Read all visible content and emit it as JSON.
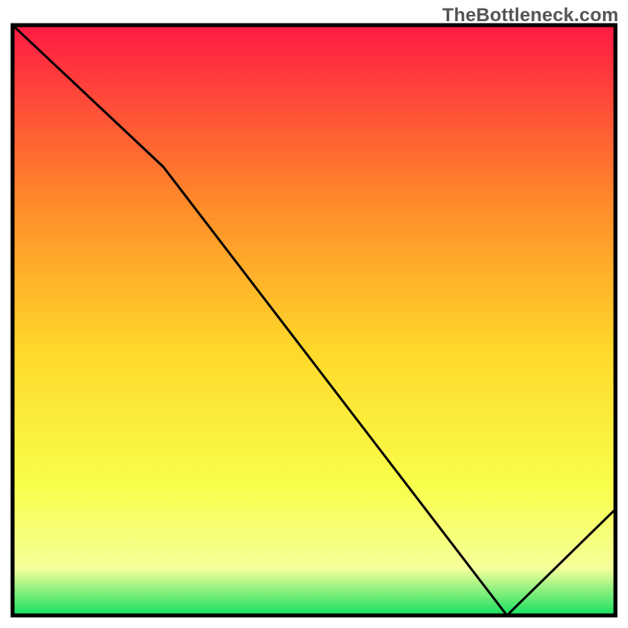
{
  "watermark": "TheBottleneck.com",
  "chart_data": {
    "type": "line",
    "title": "TheBottleneck.com",
    "xlabel": "",
    "ylabel": "",
    "xlim": [
      0,
      100
    ],
    "ylim": [
      0,
      100
    ],
    "series": [
      {
        "name": "curve",
        "x": [
          0,
          25,
          82,
          100
        ],
        "y": [
          100,
          76,
          0,
          18
        ]
      }
    ],
    "gradient_colors": {
      "top": "#ff1a44",
      "upper_mid": "#ff8a2a",
      "mid": "#ffd82a",
      "lower_mid": "#f8ff4a",
      "band": "#f6ff9a",
      "bottom": "#14e060"
    },
    "annotation": {
      "text": "",
      "x": 78,
      "y": 1.5,
      "color": "#c0392b"
    },
    "frame": {
      "stroke": "#000000",
      "stroke_width": 5
    }
  }
}
